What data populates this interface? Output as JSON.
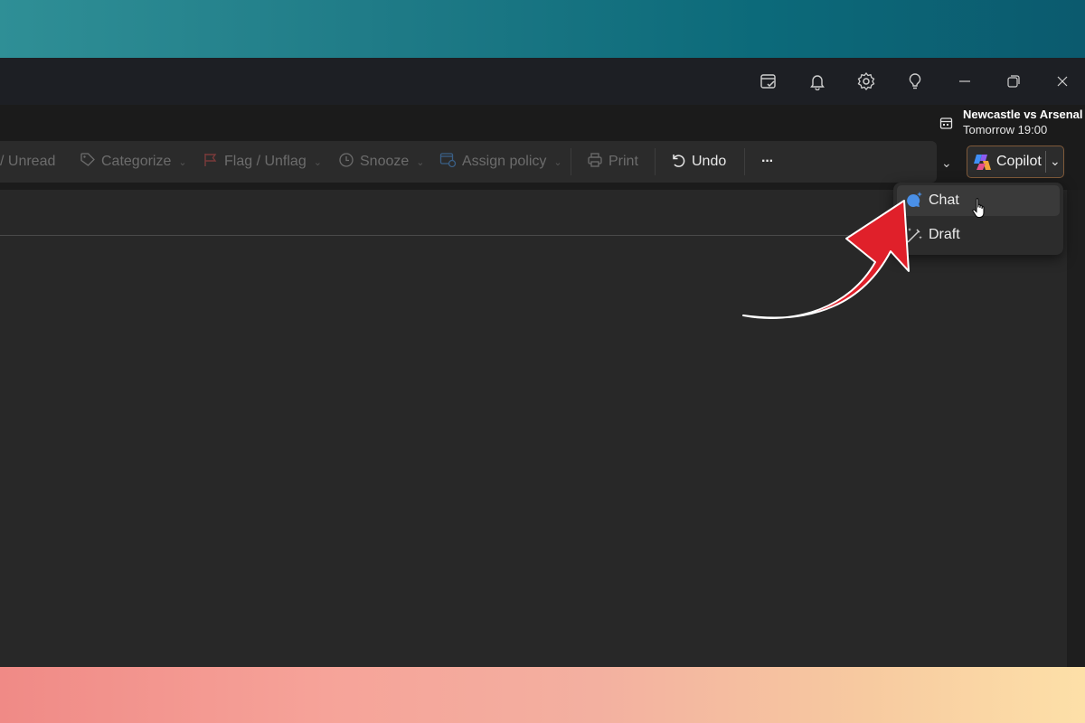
{
  "toolbar": {
    "items": [
      {
        "label": "/ Unread",
        "icon": "none"
      },
      {
        "label": "Categorize",
        "icon": "tag-icon"
      },
      {
        "label": "Flag / Unflag",
        "icon": "flag-icon"
      },
      {
        "label": "Snooze",
        "icon": "clock-icon"
      },
      {
        "label": "Assign policy",
        "icon": "policy-icon"
      },
      {
        "label": "Print",
        "icon": "printer-icon"
      },
      {
        "label": "Undo",
        "icon": "undo-icon"
      },
      {
        "label": "···",
        "icon": "more-icon"
      }
    ]
  },
  "reminder": {
    "title": "Newcastle vs Arsenal",
    "time": "Tomorrow 19:00"
  },
  "copilot": {
    "label": "Copilot",
    "menu": [
      {
        "label": "Chat",
        "icon": "copilot-chat-icon"
      },
      {
        "label": "Draft",
        "icon": "draft-wand-icon"
      }
    ]
  },
  "colors": {
    "accent_arrow": "#e0202a",
    "copilot_border": "#7f5a3a",
    "window_bg": "#282828"
  }
}
